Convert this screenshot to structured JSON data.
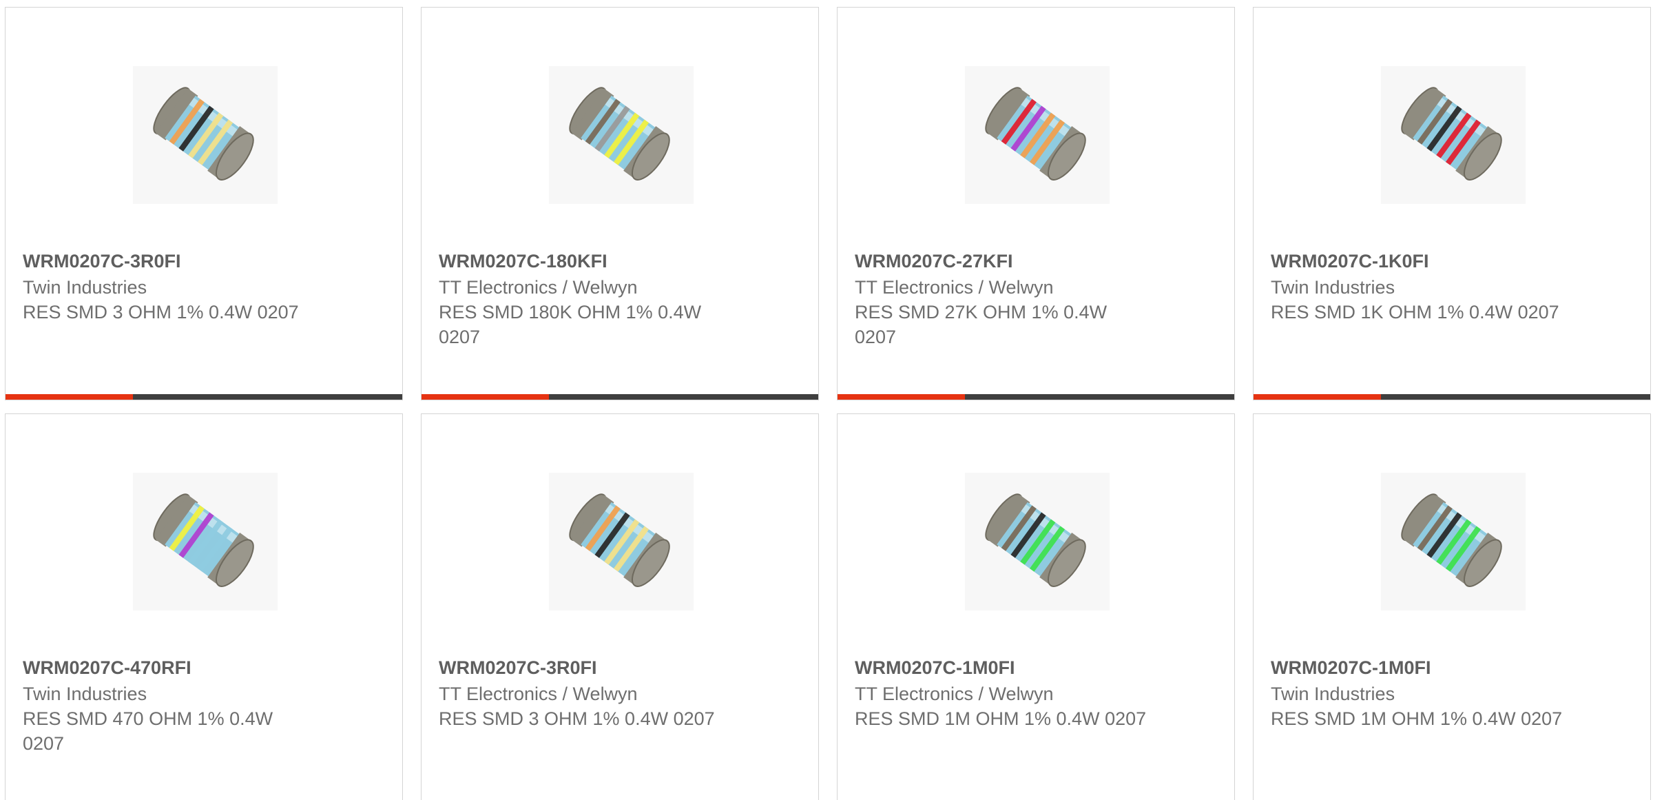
{
  "products": [
    {
      "part_number": "WRM0207C-3R0FI",
      "manufacturer": "Twin Industries",
      "description": "RES SMD 3 OHM 1% 0.4W 0207",
      "bands": [
        "#f0a050",
        "#2a2a2a",
        "#f2e08a",
        "#f2e08a"
      ],
      "progress": 0.32
    },
    {
      "part_number": "WRM0207C-180KFI",
      "manufacturer": "TT Electronics / Welwyn",
      "description": "RES SMD 180K OHM 1% 0.4W 0207",
      "bands": [
        "#7a6a58",
        "#9a9a9a",
        "#f0f040",
        "#f0f040"
      ],
      "progress": 0.32
    },
    {
      "part_number": "WRM0207C-27KFI",
      "manufacturer": "TT Electronics / Welwyn",
      "description": "RES SMD 27K OHM 1% 0.4W 0207",
      "bands": [
        "#e02030",
        "#b040d0",
        "#f0a050",
        "#f0a050"
      ],
      "progress": 0.32
    },
    {
      "part_number": "WRM0207C-1K0FI",
      "manufacturer": "Twin Industries",
      "description": "RES SMD 1K OHM 1% 0.4W 0207",
      "bands": [
        "#7a6a58",
        "#2a2a2a",
        "#e02030",
        "#e02030"
      ],
      "progress": 0.32
    },
    {
      "part_number": "WRM0207C-470RFI",
      "manufacturer": "Twin Industries",
      "description": "RES SMD 470 OHM 1% 0.4W 0207",
      "bands": [
        "#f0f040",
        "#b040d0",
        "#8fcbe0",
        "#8fcbe0"
      ],
      "progress": 0
    },
    {
      "part_number": "WRM0207C-3R0FI",
      "manufacturer": "TT Electronics / Welwyn",
      "description": "RES SMD 3 OHM 1% 0.4W 0207",
      "bands": [
        "#f0a050",
        "#2a2a2a",
        "#f2e08a",
        "#f2e08a"
      ],
      "progress": 0
    },
    {
      "part_number": "WRM0207C-1M0FI",
      "manufacturer": "TT Electronics / Welwyn",
      "description": "RES SMD 1M OHM 1% 0.4W 0207",
      "bands": [
        "#7a6a58",
        "#2a2a2a",
        "#40e050",
        "#40e050"
      ],
      "progress": 0
    },
    {
      "part_number": "WRM0207C-1M0FI",
      "manufacturer": "Twin Industries",
      "description": "RES SMD 1M OHM 1% 0.4W 0207",
      "bands": [
        "#7a6a58",
        "#2a2a2a",
        "#40e050",
        "#40e050"
      ],
      "progress": 0
    }
  ],
  "colors": {
    "progress_fill": "#e63312",
    "progress_track": "#3f3f3f",
    "resistor_body": "#8fcbe0",
    "resistor_cap": "#8f8c80"
  },
  "icons": {
    "product_image": "resistor-icon"
  }
}
